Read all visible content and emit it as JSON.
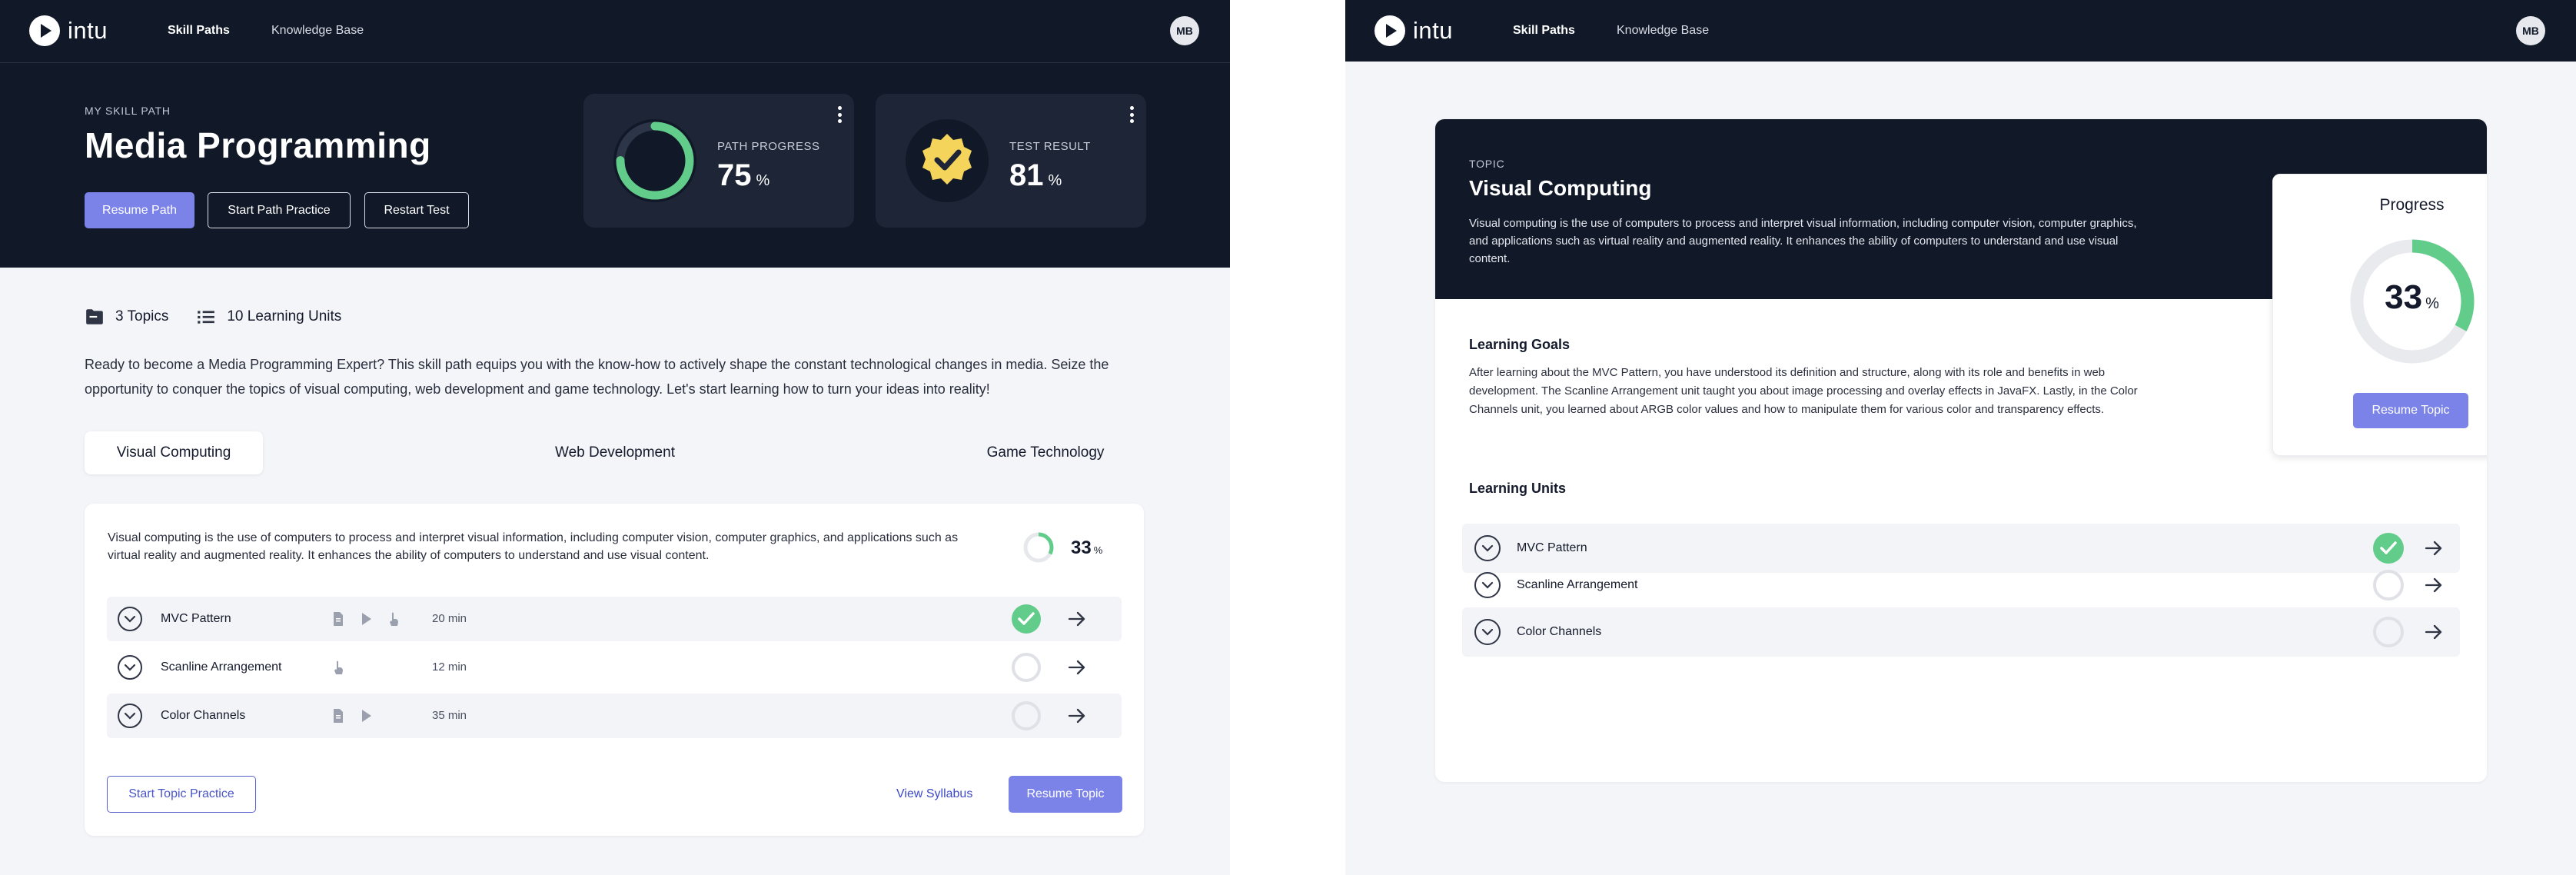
{
  "app": {
    "logo_text": "intu",
    "nav": [
      "Skill Paths",
      "Knowledge Base"
    ],
    "avatar_initials": "MB"
  },
  "colors": {
    "navy": "#111827",
    "accent": "#7b83e8",
    "success": "#62cc8a",
    "badge": "#f5d45c"
  },
  "left": {
    "eyebrow": "MY SKILL PATH",
    "title": "Media Programming",
    "buttons": {
      "resume_path": "Resume Path",
      "start_practice": "Start Path Practice",
      "restart_test": "Restart Test"
    },
    "path_progress": {
      "label": "PATH PROGRESS",
      "value": "75",
      "unit": "%",
      "icon": "progress-ring-icon"
    },
    "test_result": {
      "label": "TEST RESULT",
      "value": "81",
      "unit": "%",
      "icon": "check-badge-icon"
    },
    "stats": {
      "topics": "3 Topics",
      "units": "10 Learning Units"
    },
    "intro": "Ready to become a Media Programming Expert? This skill path equips you with the know-how to actively shape the constant technological changes in media. Seize the opportunity to conquer the topics of visual computing, web development and game technology. Let's start learning how to turn your ideas into reality!",
    "tabs": [
      "Visual Computing",
      "Web Development",
      "Game Technology"
    ],
    "panel": {
      "description": "Visual computing is the use of computers to process and interpret visual information, including computer vision, computer graphics, and applications such as virtual reality and augmented reality. It enhances the ability of computers to understand and use visual content.",
      "progress_value": "33",
      "progress_unit": "%",
      "units": [
        {
          "title": "MVC Pattern",
          "duration": "20 min",
          "types": [
            "document-icon",
            "video-icon",
            "hand-icon"
          ],
          "completed": true
        },
        {
          "title": "Scanline Arrangement",
          "duration": "12 min",
          "types": [
            "hand-icon"
          ],
          "completed": false
        },
        {
          "title": "Color Channels",
          "duration": "35 min",
          "types": [
            "document-icon",
            "video-icon"
          ],
          "completed": false
        }
      ],
      "buttons": {
        "start_topic_practice": "Start Topic Practice",
        "view_syllabus": "View Syllabus",
        "resume_topic": "Resume Topic"
      }
    }
  },
  "right": {
    "eyebrow": "TOPIC",
    "title": "Visual Computing",
    "description": "Visual computing is the use of computers to process and interpret visual information, including computer vision, computer graphics, and applications such as virtual reality and augmented reality. It enhances the ability of computers to understand and use visual content.",
    "goals_title": "Learning Goals",
    "goals_text": "After learning about the MVC Pattern, you have understood its definition and structure, along with its role and benefits in web development. The Scanline Arrangement unit taught you about image processing and overlay effects in JavaFX. Lastly, in the Color Channels unit, you learned about ARGB color values and how to manipulate them for various color and transparency effects.",
    "progress_title": "Progress",
    "progress_value": "33",
    "progress_unit": "%",
    "resume_topic": "Resume Topic",
    "units_title": "Learning Units",
    "units": [
      {
        "title": "MVC Pattern",
        "completed": true
      },
      {
        "title": "Scanline Arrangement",
        "completed": false
      },
      {
        "title": "Color Channels",
        "completed": false
      }
    ]
  }
}
